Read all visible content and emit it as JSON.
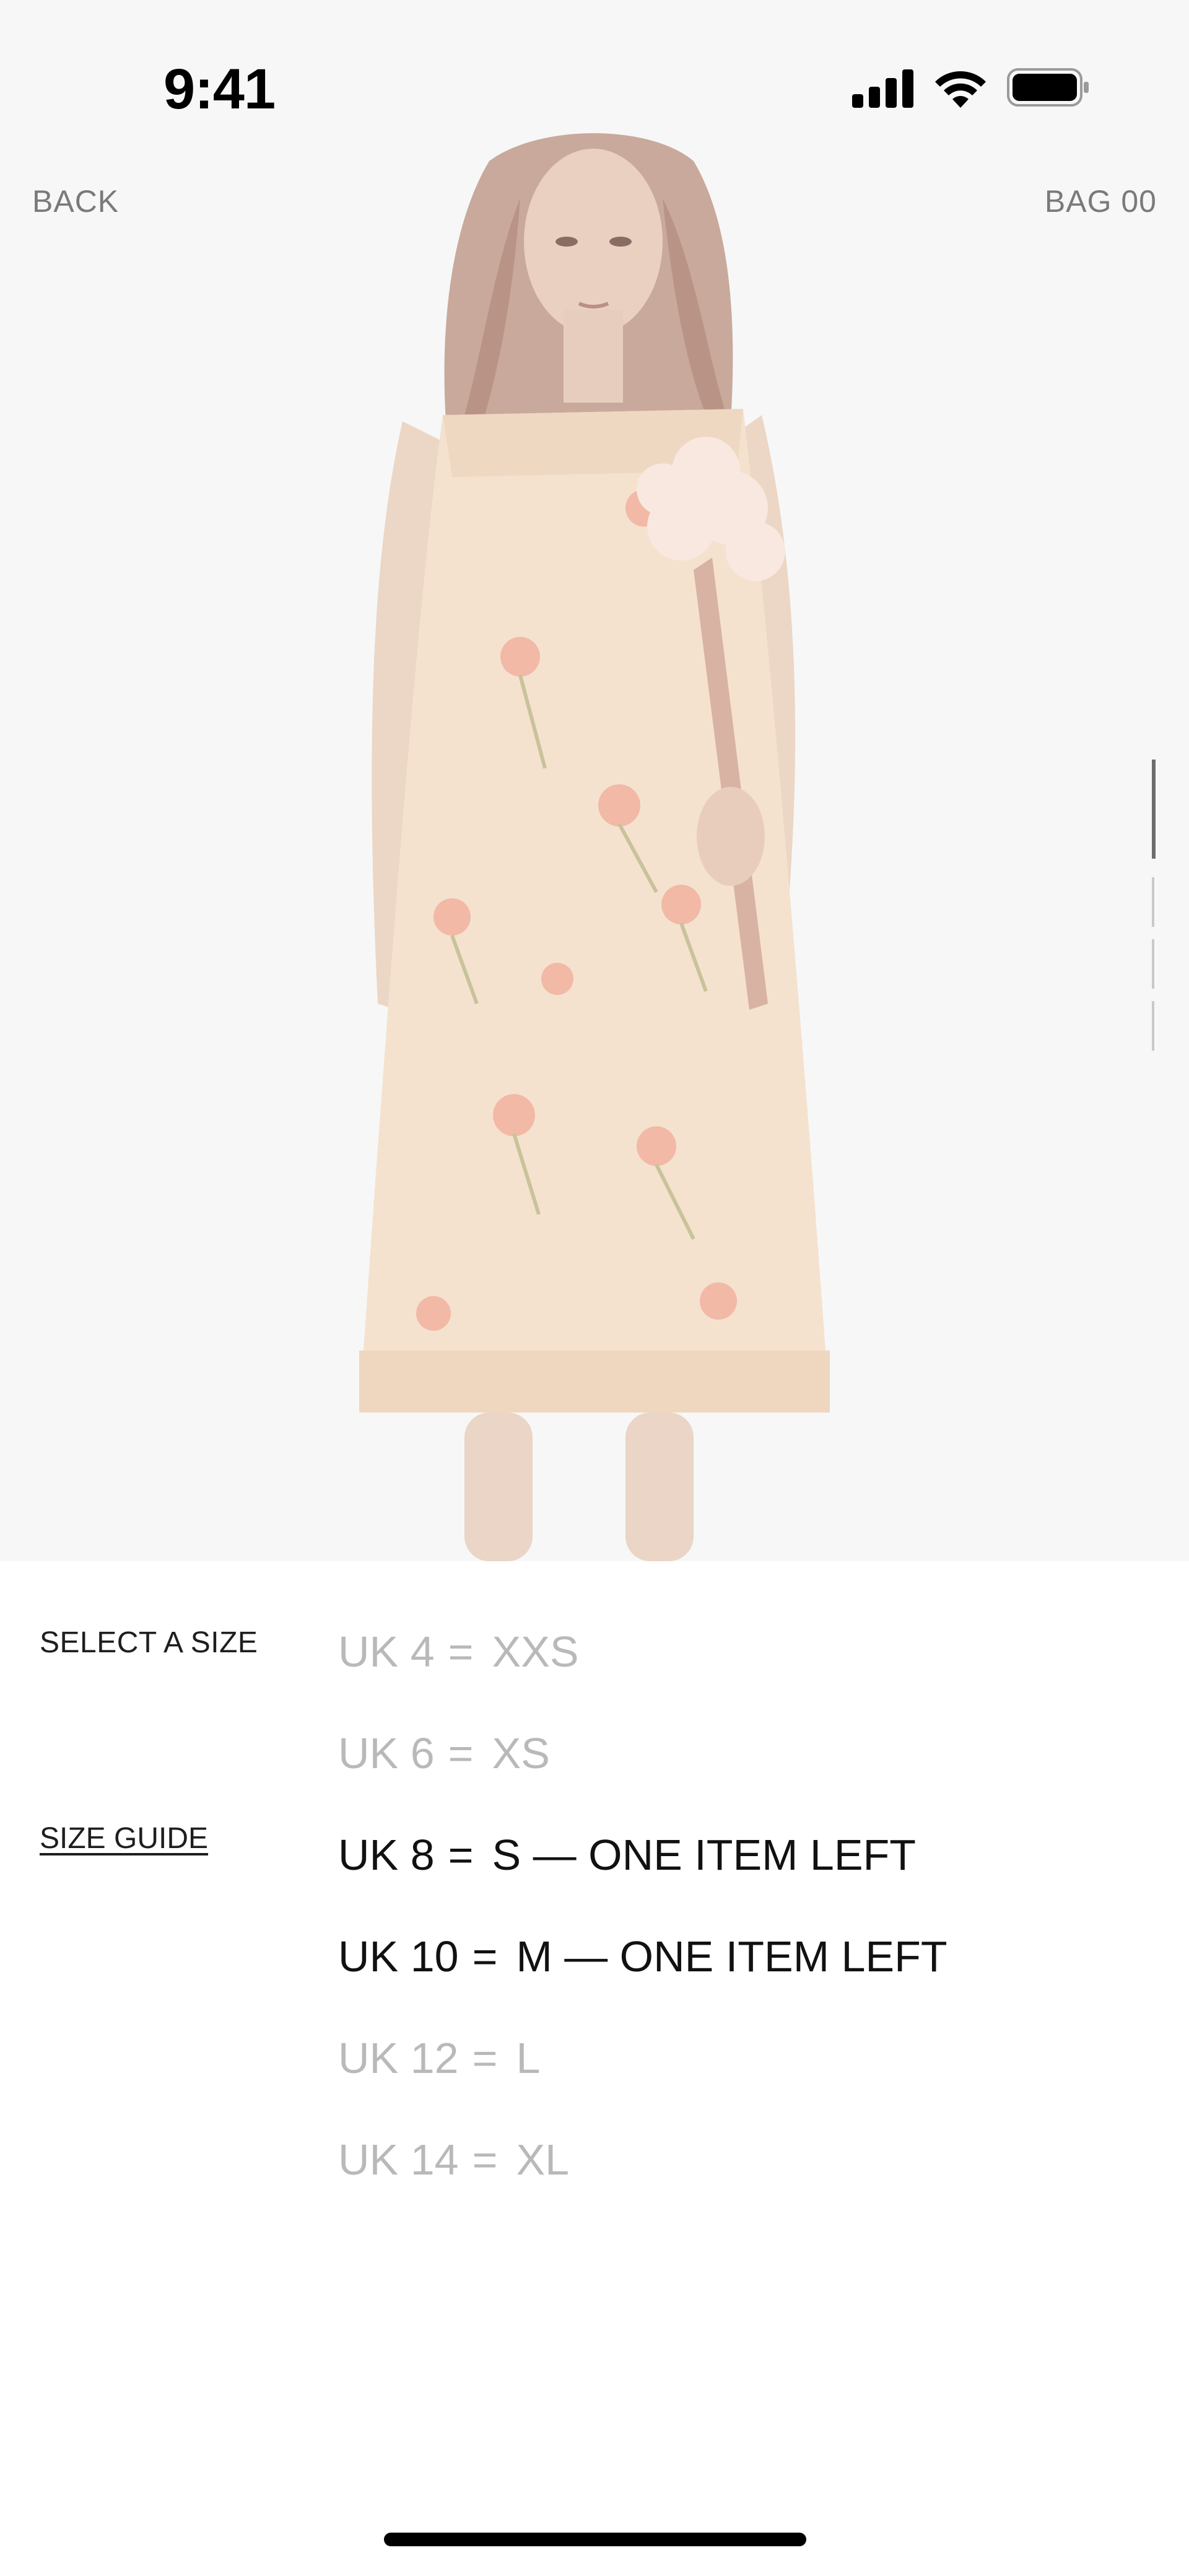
{
  "status_bar": {
    "time": "9:41",
    "signal_icon": "cellular-signal-icon",
    "wifi_icon": "wifi-icon",
    "battery_icon": "battery-full-icon"
  },
  "nav": {
    "back_label": "BACK",
    "bag_label": "BAG 00"
  },
  "gallery": {
    "image_alt": "product-photo-icon",
    "page_count": 4,
    "active_page": 1
  },
  "size_selector": {
    "title": "SELECT A SIZE",
    "guide_label": "SIZE GUIDE",
    "sizes": [
      {
        "uk": "UK 4",
        "eq": "=",
        "size": "XXS",
        "status": "",
        "available": false
      },
      {
        "uk": "UK 6",
        "eq": "=",
        "size": "XS",
        "status": "",
        "available": false
      },
      {
        "uk": "UK 8",
        "eq": "=",
        "size": "S",
        "status": "— ONE ITEM LEFT",
        "available": true
      },
      {
        "uk": "UK 10",
        "eq": "=",
        "size": "M",
        "status": "— ONE ITEM LEFT",
        "available": true
      },
      {
        "uk": "UK 12",
        "eq": "=",
        "size": "L",
        "status": "",
        "available": false
      },
      {
        "uk": "UK 14",
        "eq": "=",
        "size": "XL",
        "status": "",
        "available": false
      }
    ]
  },
  "colors": {
    "available": "#111111",
    "unavailable": "#b9b9b9",
    "hero_bg": "#f7f7f7"
  }
}
